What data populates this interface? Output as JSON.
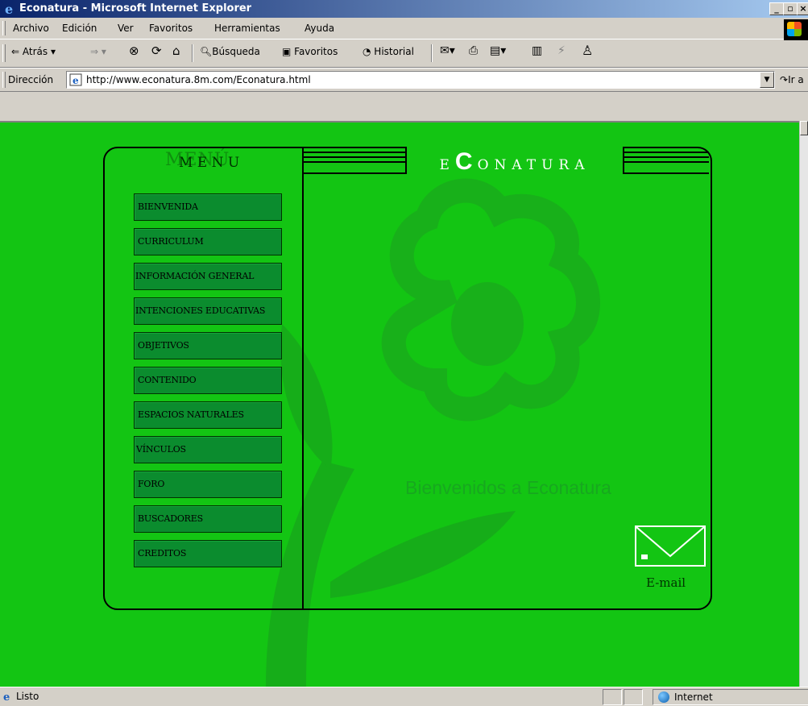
{
  "window": {
    "title": "Econatura - Microsoft Internet Explorer",
    "controls": [
      "_",
      "×"
    ]
  },
  "menubar": [
    "Archivo",
    "Edición",
    "Ver",
    "Favoritos",
    "Herramientas",
    "Ayuda"
  ],
  "toolbar": {
    "back": "Atrás",
    "search": "Búsqueda",
    "favorites": "Favoritos",
    "history": "Historial"
  },
  "address": {
    "label": "Dirección",
    "url": "http://www.econatura.8m.com/Econatura.html",
    "go": "Ir a"
  },
  "page": {
    "menu_title": "M E N U",
    "menu_title_shadow": "MENÚ",
    "brand_initial": "C",
    "brand_prefix": "E",
    "brand_rest": "ONATURA",
    "welcome": "Bienvenidos a Econatura",
    "email": "E-mail",
    "menu_items": [
      "BIENVENIDA",
      "CURRICULUM",
      "INFORMACIÓN GENERAL",
      "INTENCIONES EDUCATIVAS",
      "OBJETIVOS",
      "CONTENIDO",
      "ESPACIOS NATURALES",
      "VÍNCULOS",
      "FORO",
      "BUSCADORES",
      "CREDITOS"
    ]
  },
  "status": {
    "text": "Listo",
    "zone": "Internet"
  },
  "colors": {
    "background": "#13c513",
    "button": "#0b8c2e",
    "flower": "#17a81f"
  }
}
